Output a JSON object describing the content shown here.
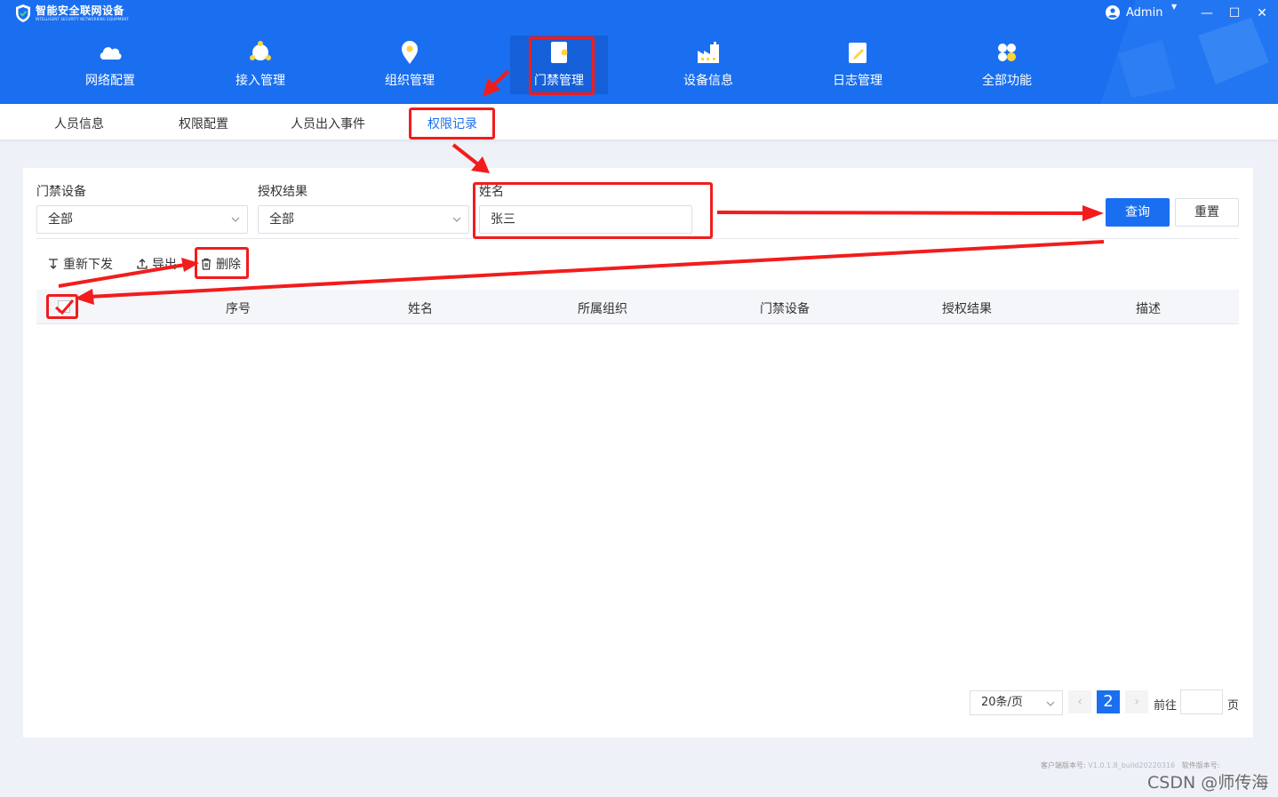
{
  "app": {
    "title": "智能安全联网设备",
    "subtitle": "INTELLIGENT SECURITY NETWORKING EQUIPMENT",
    "user": "Admin"
  },
  "nav": [
    {
      "label": "网络配置",
      "icon": "cloud-icon"
    },
    {
      "label": "接入管理",
      "icon": "network-nodes-icon"
    },
    {
      "label": "组织管理",
      "icon": "location-pin-icon"
    },
    {
      "label": "门禁管理",
      "icon": "door-card-icon",
      "active": true
    },
    {
      "label": "设备信息",
      "icon": "factory-icon"
    },
    {
      "label": "日志管理",
      "icon": "log-edit-icon"
    },
    {
      "label": "全部功能",
      "icon": "apps-grid-icon"
    }
  ],
  "subtabs": [
    {
      "label": "人员信息"
    },
    {
      "label": "权限配置"
    },
    {
      "label": "人员出入事件"
    },
    {
      "label": "权限记录",
      "active": true
    }
  ],
  "filters": {
    "device_label": "门禁设备",
    "device_value": "全部",
    "result_label": "授权结果",
    "result_value": "全部",
    "name_label": "姓名",
    "name_value": "张三",
    "query_button": "查询",
    "reset_button": "重置"
  },
  "toolbar": {
    "resend": "重新下发",
    "export": "导出",
    "delete": "删除"
  },
  "table": {
    "columns": [
      "序号",
      "姓名",
      "所属组织",
      "门禁设备",
      "授权结果",
      "描述"
    ]
  },
  "pagination": {
    "page_size": "20条/页",
    "current_page": "2",
    "goto_label": "前往",
    "page_suffix": "页"
  },
  "footer": {
    "client_version_label": "客户端版本号:",
    "client_version": "V1.0.1.8_build20220316",
    "software_version_label": "软件版本号:",
    "watermark": "CSDN @师传海"
  },
  "colors": {
    "brand_blue": "#1a6ff0",
    "annotation_red": "#f21c1c"
  }
}
